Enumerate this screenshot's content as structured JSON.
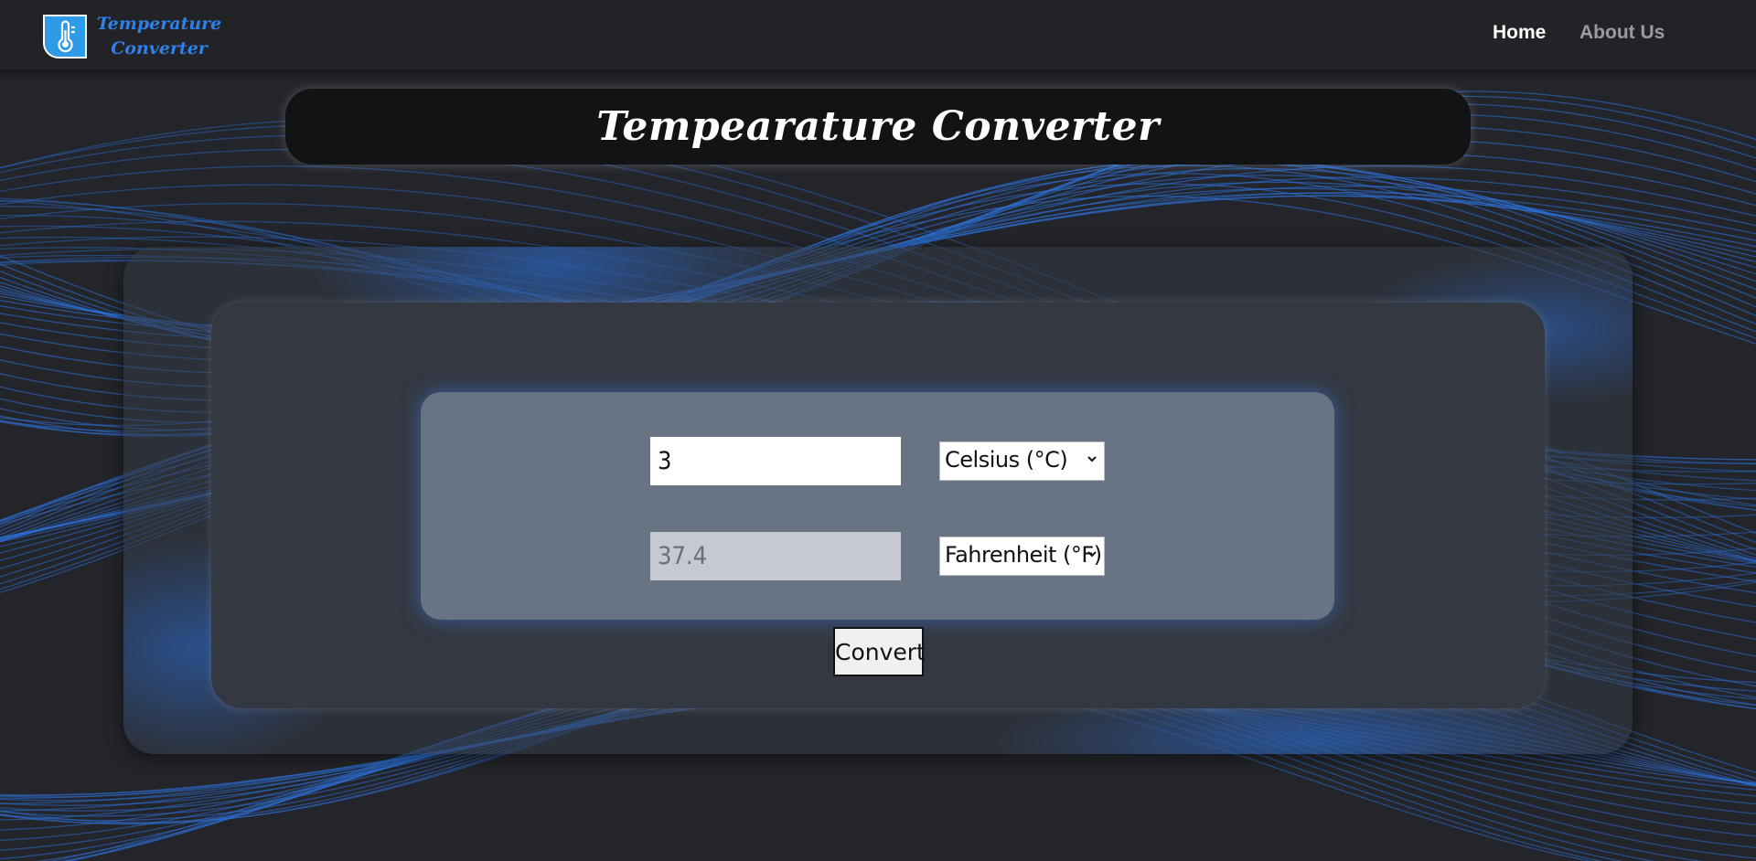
{
  "window": {
    "title": "Temperature Converter"
  },
  "navbar": {
    "brand_line1": "Temperature",
    "brand_line2": "Converter",
    "links": [
      {
        "label": "Home",
        "active": true
      },
      {
        "label": "About Us",
        "active": false
      }
    ]
  },
  "banner": {
    "title": "Tempearature Converter"
  },
  "converter": {
    "input_value": "3",
    "output_value": "37.4",
    "from_unit": "Celsius (°C)",
    "to_unit": "Fahrenheit (°F)",
    "convert_label": "Convert"
  },
  "icons": {
    "brand": "thermometer-icon",
    "select": "chevron-down-icon"
  },
  "colors": {
    "accent": "#2f80e8",
    "background": "#23252a",
    "navbar": "#212327",
    "panel": "#687384",
    "inner_card": "#343841"
  }
}
